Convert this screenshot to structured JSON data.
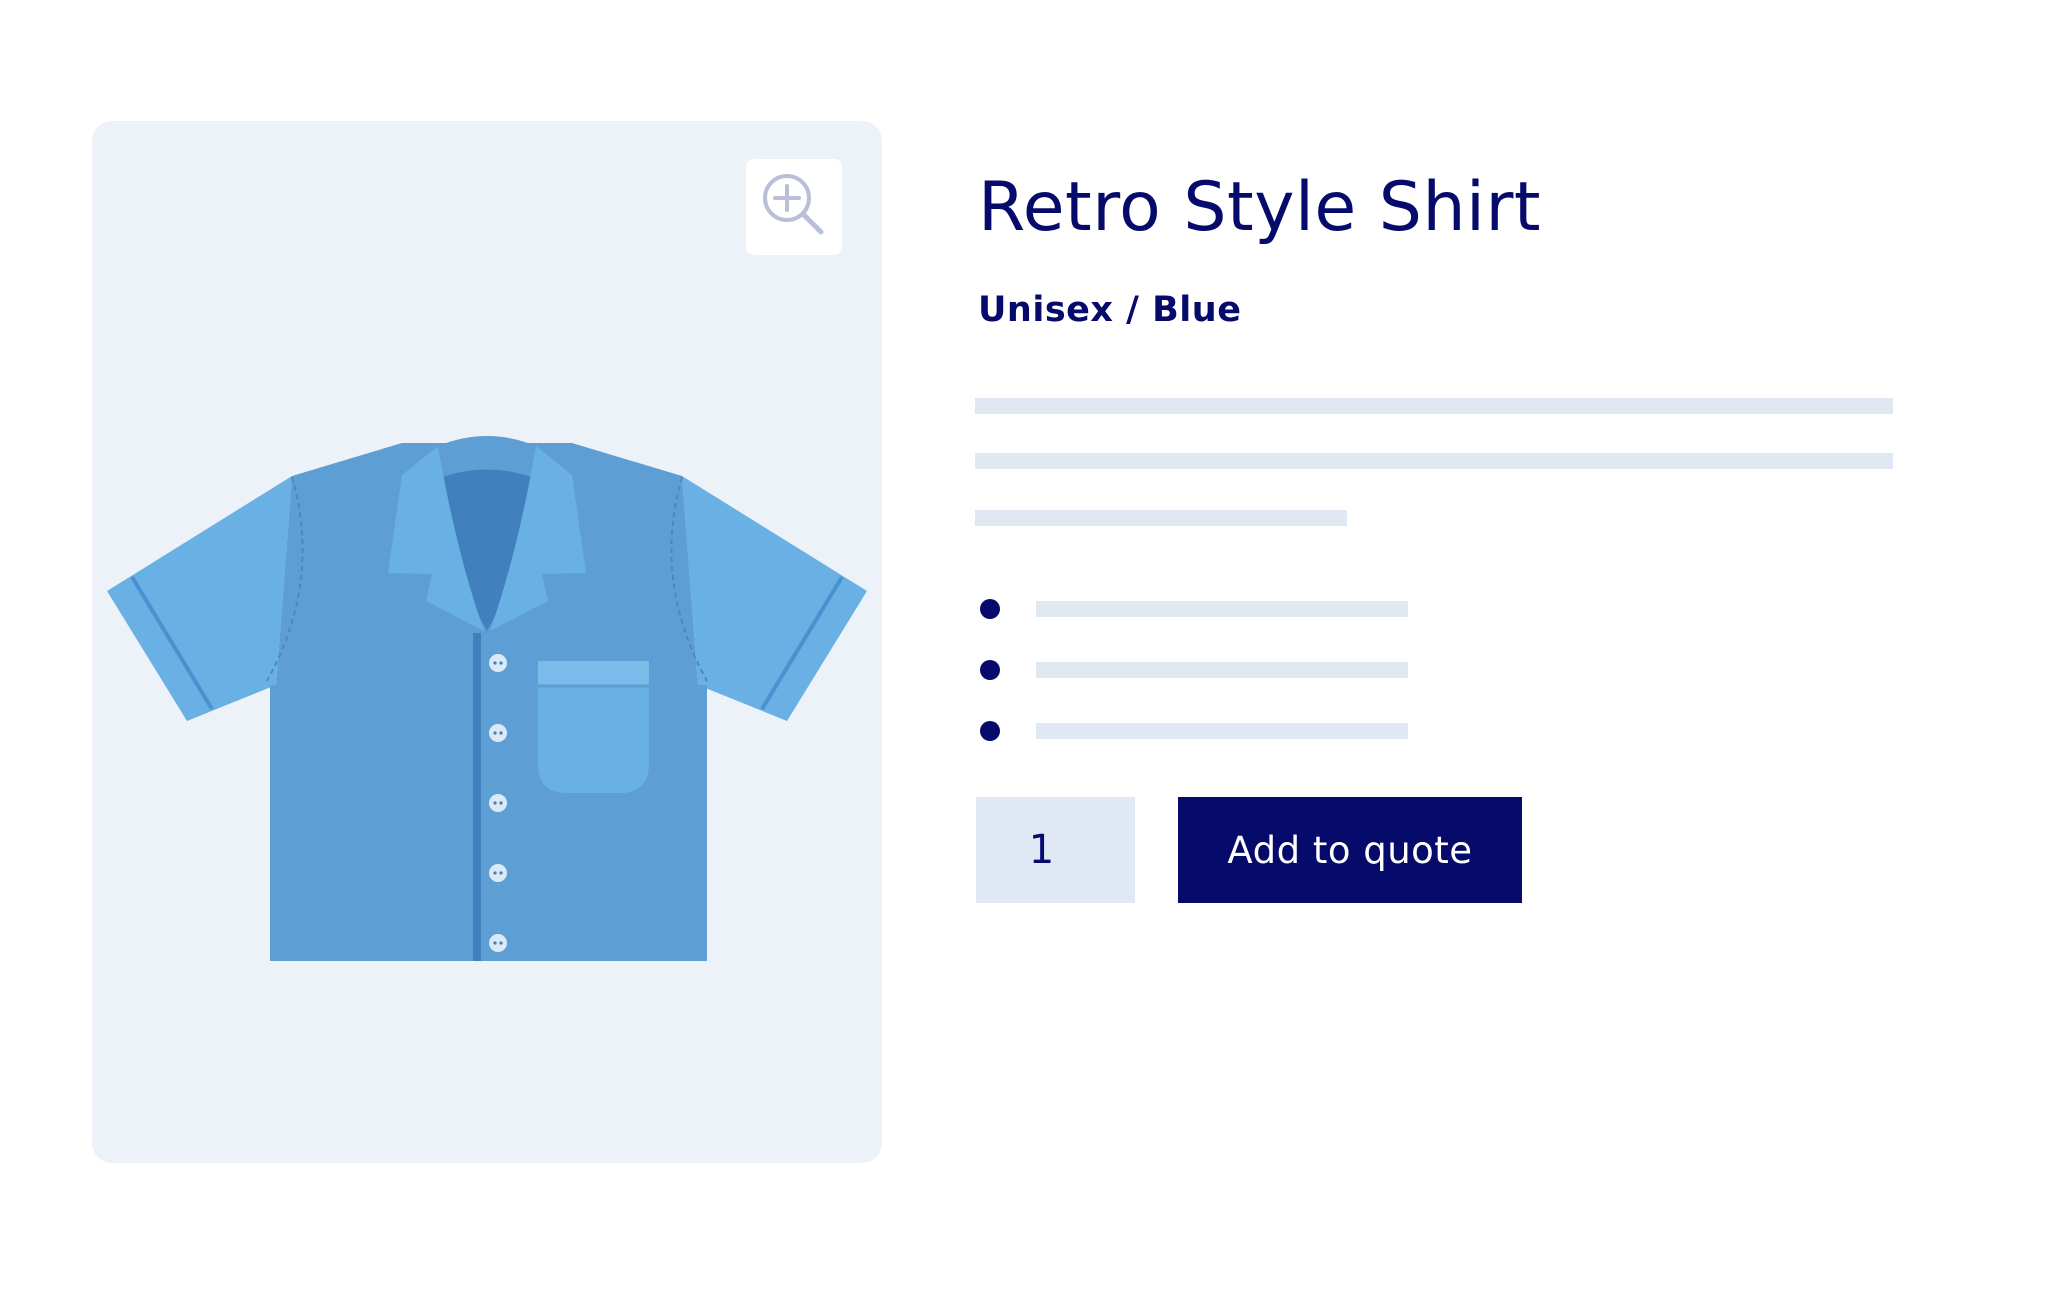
{
  "product": {
    "title": "Retro Style Shirt",
    "variant": "Unisex / Blue",
    "image": {
      "subject": "shirt-illustration",
      "zoom_icon": "zoom-in-icon"
    },
    "bullets_count": 3
  },
  "purchase": {
    "quantity": "1",
    "add_button_label": "Add to quote"
  },
  "colors": {
    "brand_navy": "#050a6b",
    "image_background": "#edf2f9",
    "placeholder_line": "#dfe8f3",
    "shirt_body": "#5d9fd4",
    "shirt_sleeve": "#69b0e4",
    "shirt_inner_collar": "#3f80bd"
  }
}
